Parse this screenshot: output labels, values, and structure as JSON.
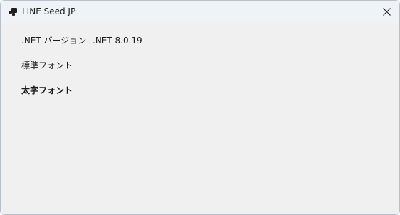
{
  "window": {
    "title": "LINE Seed JP",
    "icon": "app-window-icon",
    "close_icon": "close-icon"
  },
  "content": {
    "net_version_label": ".NET バージョン",
    "net_version_value": ".NET 8.0.19",
    "regular_font_label": "標準フォント",
    "bold_font_label": "太字フォント"
  }
}
